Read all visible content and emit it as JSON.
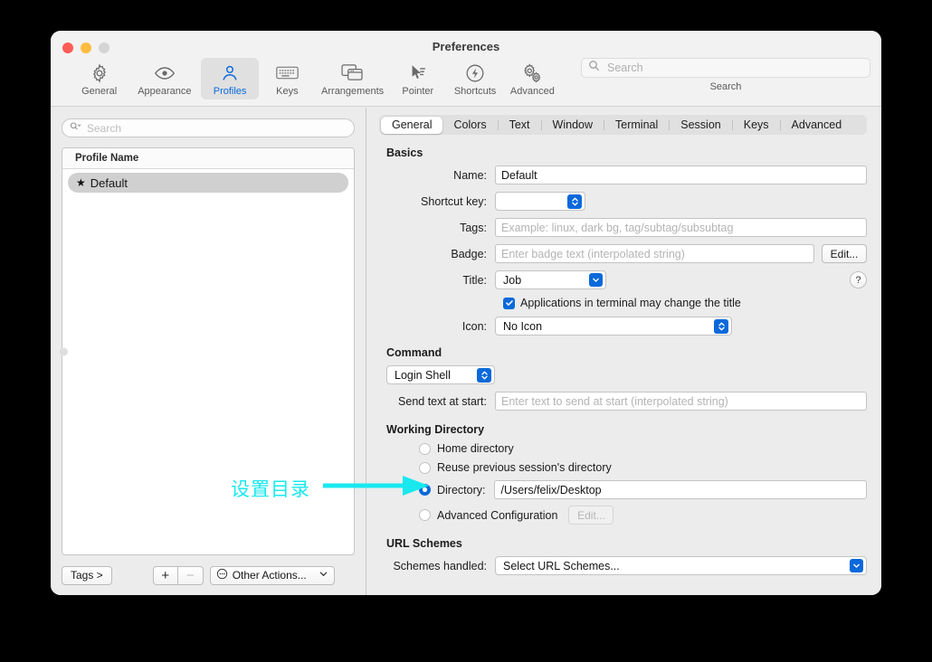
{
  "window": {
    "title": "Preferences",
    "traffic_lights": [
      "close",
      "minimize",
      "zoom"
    ]
  },
  "toolbar": {
    "items": [
      {
        "label": "General",
        "icon": "gear-icon",
        "selected": false
      },
      {
        "label": "Appearance",
        "icon": "eye-icon",
        "selected": false
      },
      {
        "label": "Profiles",
        "icon": "person-icon",
        "selected": true
      },
      {
        "label": "Keys",
        "icon": "keyboard-icon",
        "selected": false
      },
      {
        "label": "Arrangements",
        "icon": "windows-icon",
        "selected": false
      },
      {
        "label": "Pointer",
        "icon": "cursor-icon",
        "selected": false
      },
      {
        "label": "Shortcuts",
        "icon": "bolt-icon",
        "selected": false
      },
      {
        "label": "Advanced",
        "icon": "gears-icon",
        "selected": false
      }
    ],
    "search": {
      "placeholder": "Search",
      "value": "",
      "caption": "Search"
    }
  },
  "sidebar": {
    "search": {
      "placeholder": "Search",
      "value": ""
    },
    "table": {
      "header": "Profile Name",
      "rows": [
        {
          "star": "★",
          "name": "Default",
          "selected": true
        }
      ]
    },
    "footer": {
      "tags_label": "Tags >",
      "add_label": "+",
      "remove_label": "−",
      "other_actions_label": "Other Actions...",
      "other_actions_chevron": "⌄"
    }
  },
  "pane": {
    "tabs": [
      {
        "label": "General",
        "selected": true
      },
      {
        "label": "Colors",
        "selected": false
      },
      {
        "label": "Text",
        "selected": false
      },
      {
        "label": "Window",
        "selected": false
      },
      {
        "label": "Terminal",
        "selected": false
      },
      {
        "label": "Session",
        "selected": false
      },
      {
        "label": "Keys",
        "selected": false
      },
      {
        "label": "Advanced",
        "selected": false
      }
    ],
    "basics": {
      "heading": "Basics",
      "name_label": "Name:",
      "name_value": "Default",
      "shortcut_label": "Shortcut key:",
      "shortcut_value": "",
      "tags_label": "Tags:",
      "tags_placeholder": "Example: linux, dark bg, tag/subtag/subsubtag",
      "badge_label": "Badge:",
      "badge_placeholder": "Enter badge text (interpolated string)",
      "badge_edit_label": "Edit...",
      "title_label": "Title:",
      "title_value": "Job",
      "help_label": "?",
      "checkbox_label": "Applications in terminal may change the title",
      "checkbox_checked": true,
      "icon_label": "Icon:",
      "icon_value": "No Icon"
    },
    "command": {
      "heading": "Command",
      "shell_value": "Login Shell",
      "send_text_label": "Send text at start:",
      "send_text_placeholder": "Enter text to send at start (interpolated string)"
    },
    "working_directory": {
      "heading": "Working Directory",
      "options": [
        {
          "label": "Home directory",
          "selected": false
        },
        {
          "label": "Reuse previous session's directory",
          "selected": false
        },
        {
          "label": "Directory:",
          "selected": true
        },
        {
          "label": "Advanced Configuration",
          "selected": false
        }
      ],
      "directory_value": "/Users/felix/Desktop",
      "advanced_edit_label": "Edit...",
      "advanced_edit_disabled": true
    },
    "url_schemes": {
      "heading": "URL Schemes",
      "schemes_label": "Schemes handled:",
      "schemes_value": "Select URL Schemes..."
    }
  },
  "annotation": {
    "text": "设置目录",
    "color": "#19e8ef",
    "arrow": "right-arrow"
  }
}
